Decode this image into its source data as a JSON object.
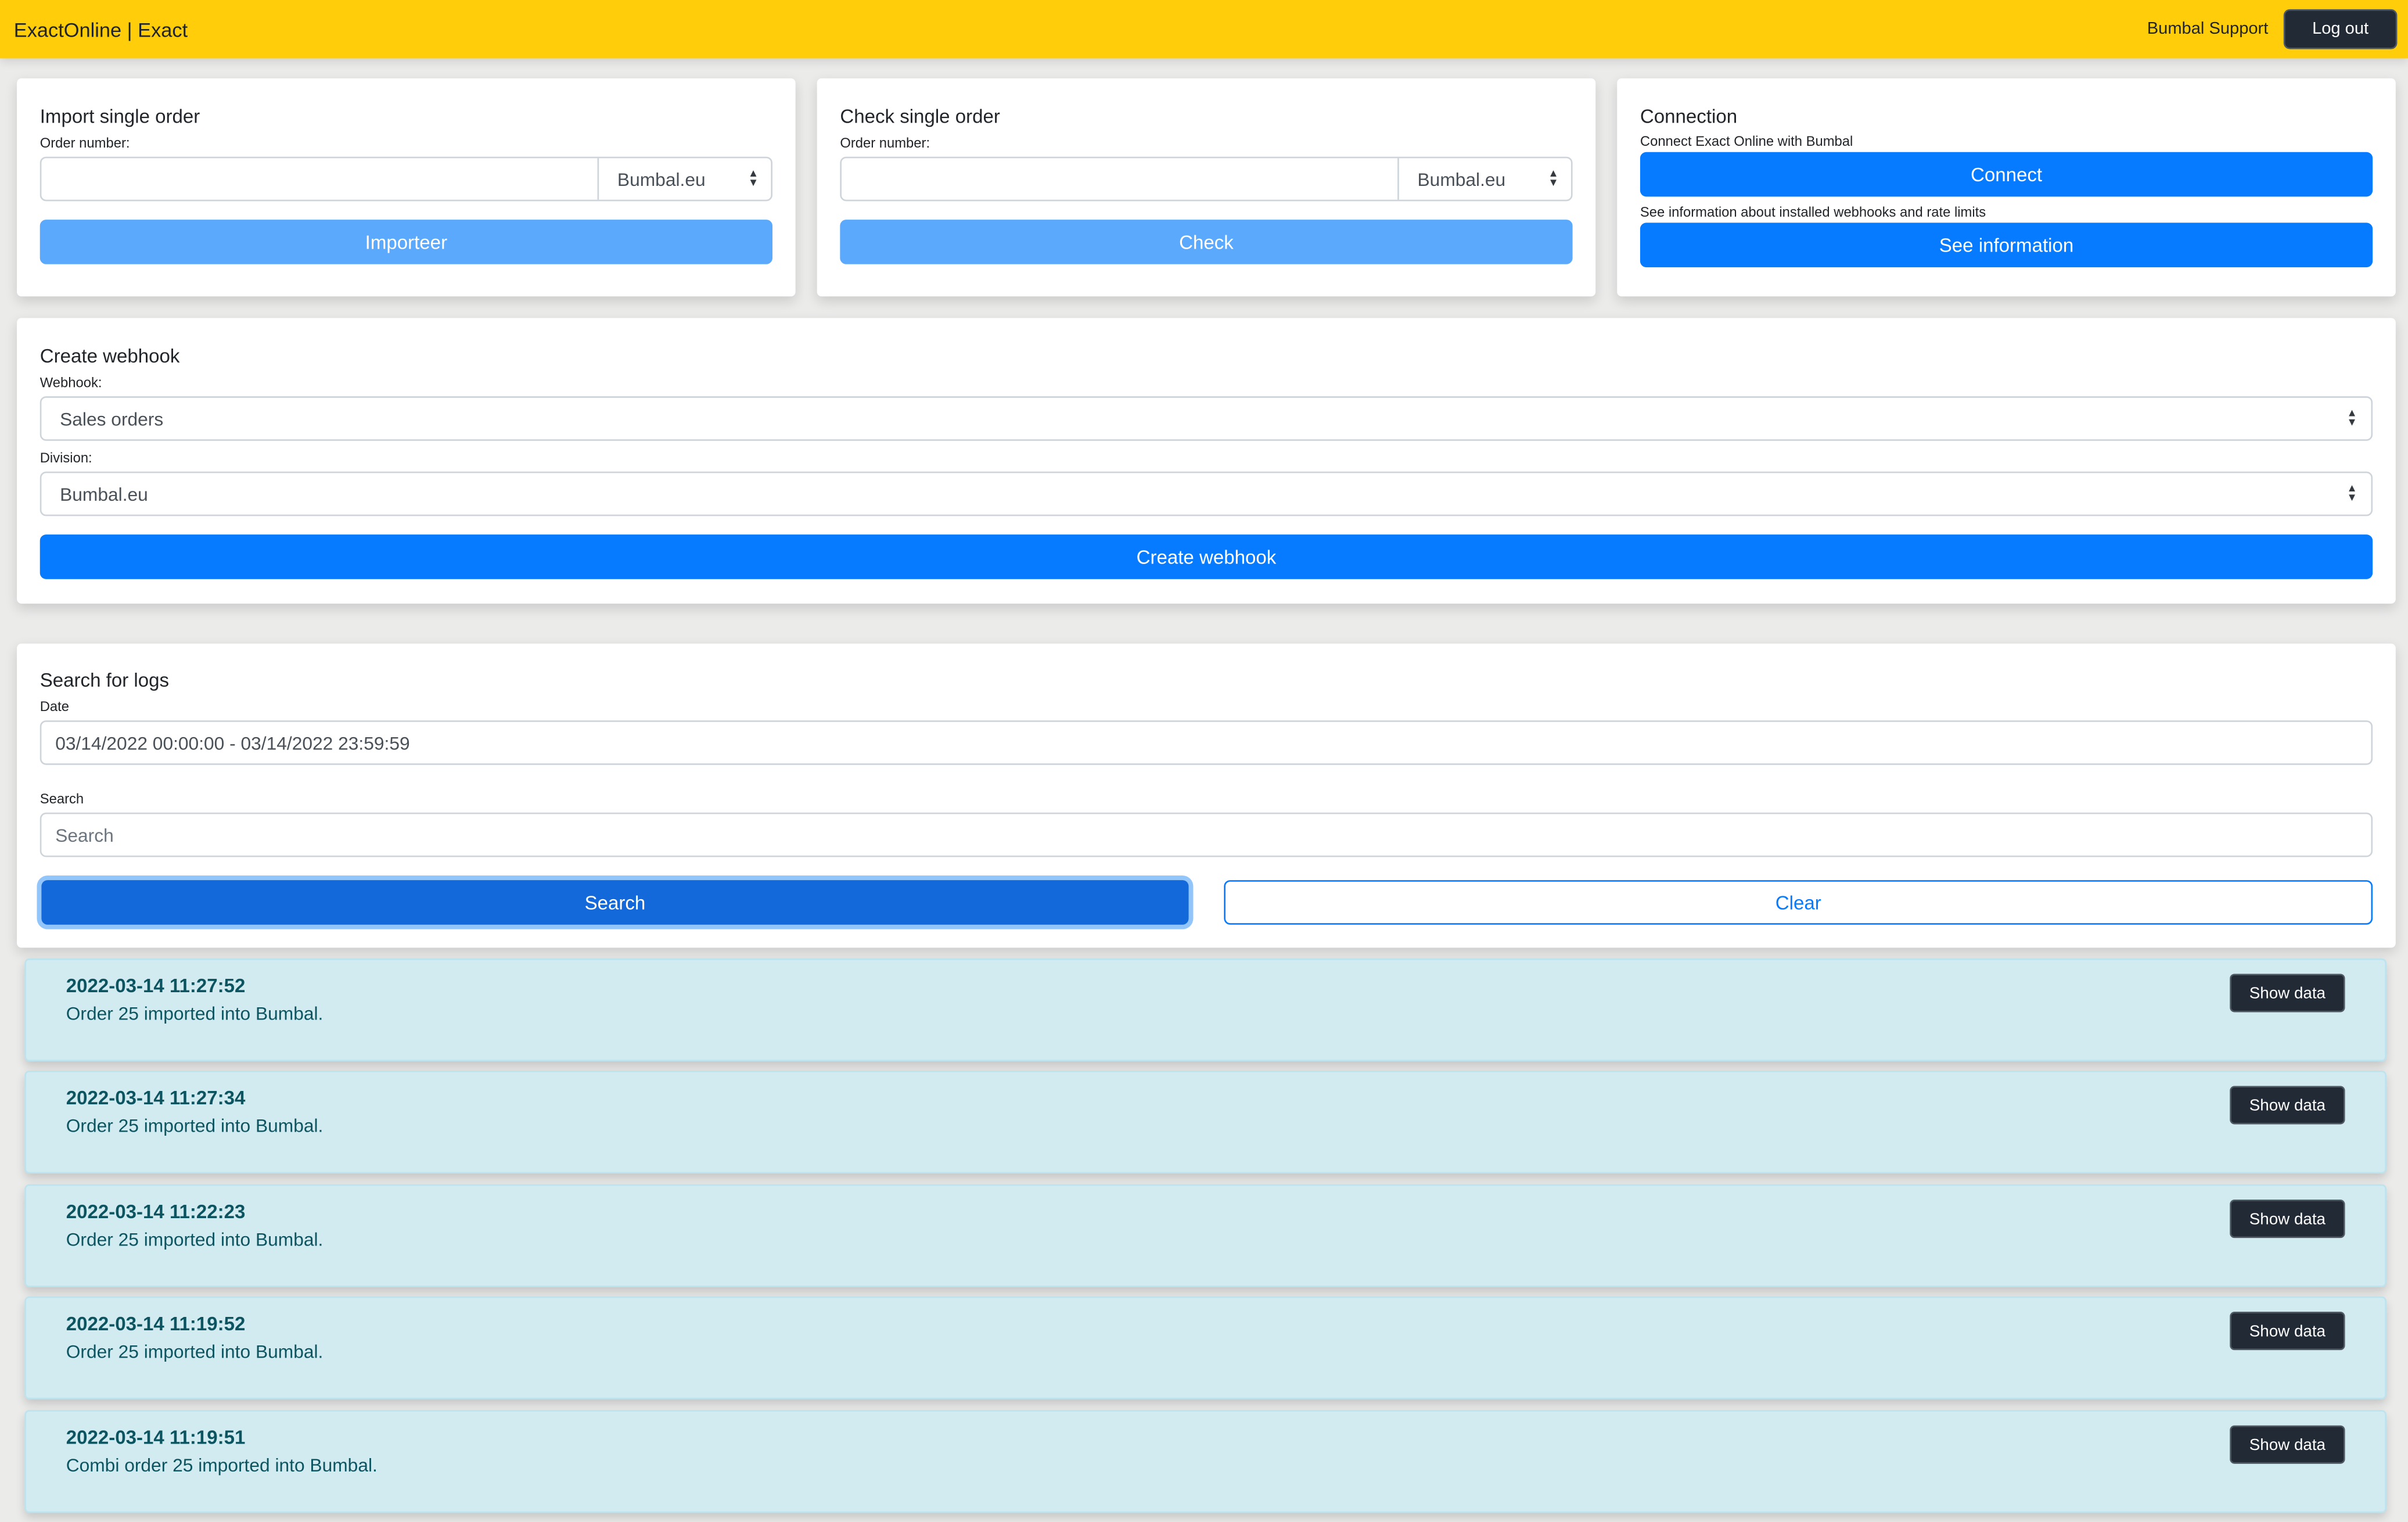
{
  "navbar": {
    "brand": "ExactOnline | Exact",
    "user": "Bumbal Support",
    "logout_label": "Log out"
  },
  "import_card": {
    "title": "Import single order",
    "order_label": "Order number:",
    "order_value": "",
    "division_selected": "Bumbal.eu",
    "button_label": "Importeer"
  },
  "check_card": {
    "title": "Check single order",
    "order_label": "Order number:",
    "order_value": "",
    "division_selected": "Bumbal.eu",
    "button_label": "Check"
  },
  "connection_card": {
    "title": "Connection",
    "connect_text": "Connect Exact Online with Bumbal",
    "connect_label": "Connect",
    "info_text": "See information about installed webhooks and rate limits",
    "info_label": "See information"
  },
  "webhook_card": {
    "title": "Create webhook",
    "webhook_label": "Webhook:",
    "webhook_selected": "Sales orders",
    "division_label": "Division:",
    "division_selected": "Bumbal.eu",
    "button_label": "Create webhook"
  },
  "logs_search": {
    "title": "Search for logs",
    "date_label": "Date",
    "date_value": "03/14/2022 00:00:00 - 03/14/2022 23:59:59",
    "search_label": "Search",
    "search_placeholder": "Search",
    "search_button": "Search",
    "clear_button": "Clear"
  },
  "logs": [
    {
      "time": "2022-03-14 11:27:52",
      "message": "Order 25 imported into Bumbal.",
      "button": "Show data"
    },
    {
      "time": "2022-03-14 11:27:34",
      "message": "Order 25 imported into Bumbal.",
      "button": "Show data"
    },
    {
      "time": "2022-03-14 11:22:23",
      "message": "Order 25 imported into Bumbal.",
      "button": "Show data"
    },
    {
      "time": "2022-03-14 11:19:52",
      "message": "Order 25 imported into Bumbal.",
      "button": "Show data"
    },
    {
      "time": "2022-03-14 11:19:51",
      "message": "Combi order 25 imported into Bumbal.",
      "button": "Show data"
    }
  ],
  "icons": {
    "select_arrows": "▲▼"
  },
  "colors": {
    "navbar": "#ffcd0a",
    "primary": "#077bff",
    "primary_disabled": "#5aa9fd",
    "dark": "#212a35",
    "log_bg": "#d2ebf1",
    "log_text": "#0c5460"
  }
}
